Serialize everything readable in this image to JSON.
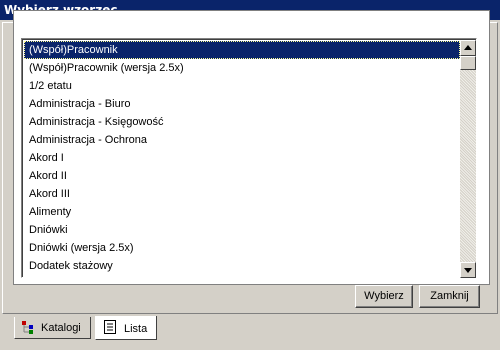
{
  "window": {
    "title": "Wybierz wzorzec"
  },
  "list": {
    "items": [
      "(Współ)Pracownik",
      "(Współ)Pracownik (wersja 2.5x)",
      "1/2 etatu",
      "Administracja - Biuro",
      "Administracja - Księgowość",
      "Administracja - Ochrona",
      "Akord I",
      "Akord II",
      "Akord III",
      "Alimenty",
      "Dniówki",
      "Dniówki (wersja 2.5x)",
      "Dodatek stażowy"
    ],
    "selected_index": 0
  },
  "buttons": {
    "wybierz": "Wybierz",
    "zamknij": "Zamknij"
  },
  "tabs": {
    "katalogi": {
      "label": "Katalogi",
      "icon": "tree-icon"
    },
    "lista": {
      "label": "Lista",
      "icon": "document-list-icon",
      "active": true
    }
  },
  "colors": {
    "titlebar": "#0a246a",
    "selection": "#0a246a",
    "face": "#d4d0c8"
  }
}
